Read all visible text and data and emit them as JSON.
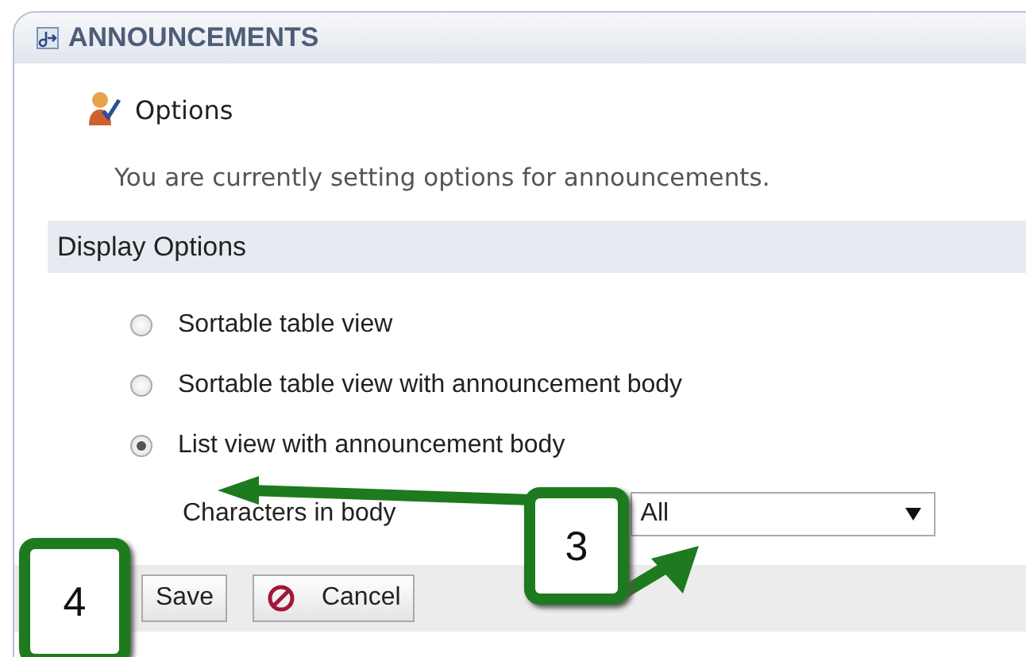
{
  "panel": {
    "title": "ANNOUNCEMENTS"
  },
  "section": {
    "title": "Options",
    "description": "You are currently setting options for announcements."
  },
  "display_options": {
    "heading": "Display Options",
    "options": [
      {
        "label": "Sortable table view",
        "selected": false
      },
      {
        "label": "Sortable table view with announcement body",
        "selected": false
      },
      {
        "label": "List view with announcement body",
        "selected": true
      }
    ],
    "characters": {
      "label": "Characters in body",
      "value": "All"
    }
  },
  "buttons": [
    {
      "label": "Save",
      "kind": "save"
    },
    {
      "label": "Cancel",
      "kind": "cancel"
    }
  ],
  "callouts": [
    {
      "number": "3"
    },
    {
      "number": "4"
    }
  ]
}
